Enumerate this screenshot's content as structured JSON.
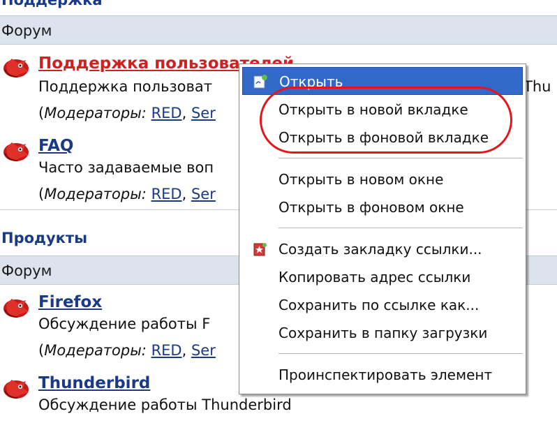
{
  "categories": [
    {
      "header": "Поддержка"
    },
    {
      "header": "Продукты"
    }
  ],
  "forum_col_label": "Форум",
  "forums": [
    {
      "title": "Поддержка пользователей",
      "desc": "Поддержка пользоват",
      "mods_label": "Модераторы:",
      "mods": [
        "RED",
        "Ser"
      ],
      "mods_prefix": "(",
      "comma": ","
    },
    {
      "title": "FAQ",
      "desc": "Часто задаваемые воп",
      "mods_label": "Модераторы:",
      "mods": [
        "RED",
        "Ser"
      ],
      "mods_prefix": "(",
      "comma": ","
    },
    {
      "title": "Firefox",
      "desc": "Обсуждение работы F",
      "mods_label": "Модераторы:",
      "mods": [
        "RED",
        "Ser"
      ],
      "mods_prefix": "(",
      "comma": ","
    },
    {
      "title": "Thunderbird",
      "desc": "Обсуждение работы Thunderbird"
    }
  ],
  "right_cut_text": "Thu",
  "context_menu": {
    "items": [
      {
        "label": "Открыть",
        "selected": true,
        "icon": "open-page-icon"
      },
      {
        "label": "Открыть в новой вкладке"
      },
      {
        "label": "Открыть в фоновой вкладке"
      },
      {
        "label": "Открыть в новом окне"
      },
      {
        "label": "Открыть в фоновом окне"
      },
      {
        "label": "Создать закладку ссылки...",
        "icon": "bookmark-star-icon"
      },
      {
        "label": "Копировать адрес ссылки"
      },
      {
        "label": "Сохранить по ссылке как..."
      },
      {
        "label": "Сохранить в папку загрузки"
      },
      {
        "label": "Проинспектировать элемент"
      }
    ]
  },
  "colors": {
    "accent": "#3269c8",
    "highlight_oval": "#e4151b",
    "link": "#1a3a86",
    "hot_title": "#d02020"
  }
}
